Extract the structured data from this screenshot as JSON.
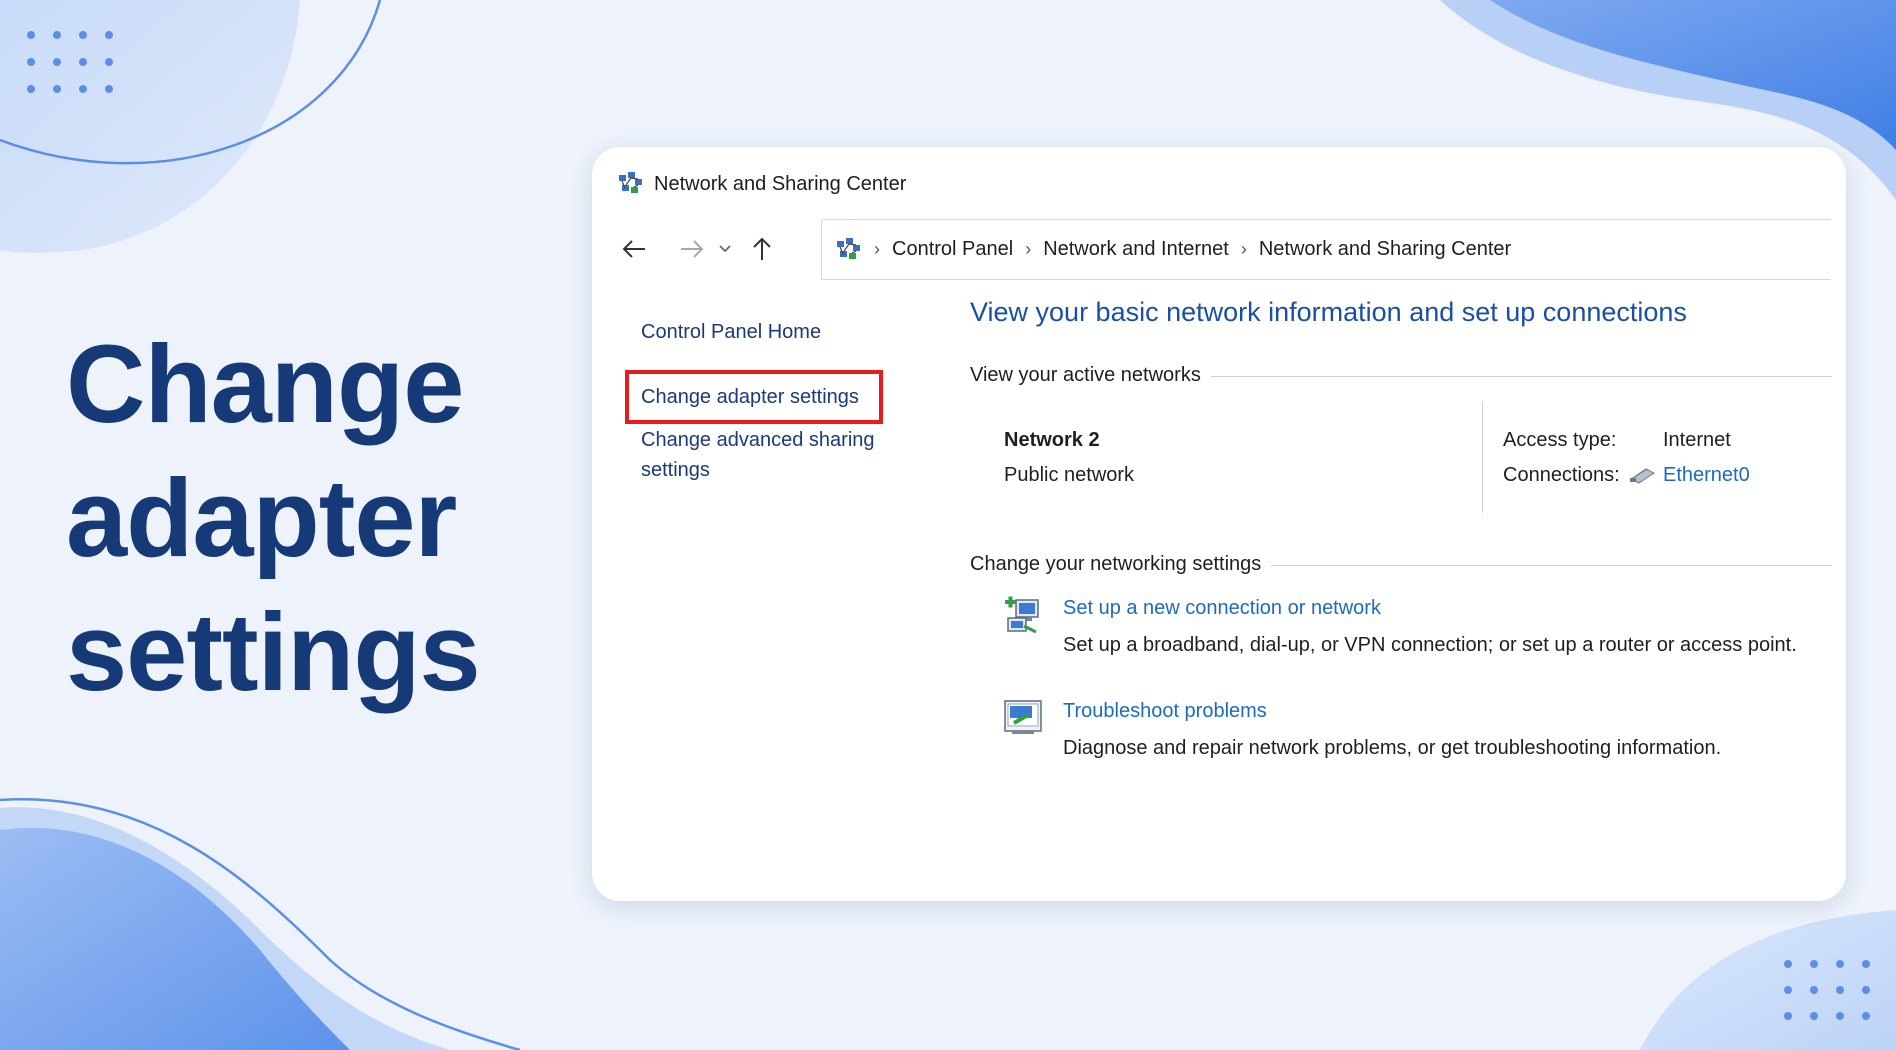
{
  "headline": {
    "line1": "Change",
    "line2": "adapter",
    "line3": "settings"
  },
  "window": {
    "title": "Network and Sharing Center",
    "breadcrumb": [
      "Control Panel",
      "Network and Internet",
      "Network and Sharing Center"
    ],
    "left_panel": {
      "home": "Control Panel Home",
      "adapter": "Change adapter settings",
      "advanced_line1": "Change advanced sharing",
      "advanced_line2": "settings"
    },
    "main": {
      "title": "View your basic network information and set up connections",
      "active_networks_label": "View your active networks",
      "network_name": "Network 2",
      "network_type": "Public network",
      "access_type_label": "Access type:",
      "access_type_value": "Internet",
      "connections_label": "Connections:",
      "connections_value": "Ethernet0",
      "change_settings_label": "Change your networking settings",
      "setup_link": "Set up a new connection or network",
      "setup_desc": "Set up a broadband, dial-up, or VPN connection; or set up a router or access point.",
      "troubleshoot_link": "Troubleshoot problems",
      "troubleshoot_desc": "Diagnose and repair network problems, or get troubleshooting information."
    }
  },
  "colors": {
    "headline": "#163a78",
    "accent_blue": "#1a4fa3",
    "link": "#1c6bbf",
    "highlight_box": "#e81c1c",
    "background": "#eef3fb"
  }
}
